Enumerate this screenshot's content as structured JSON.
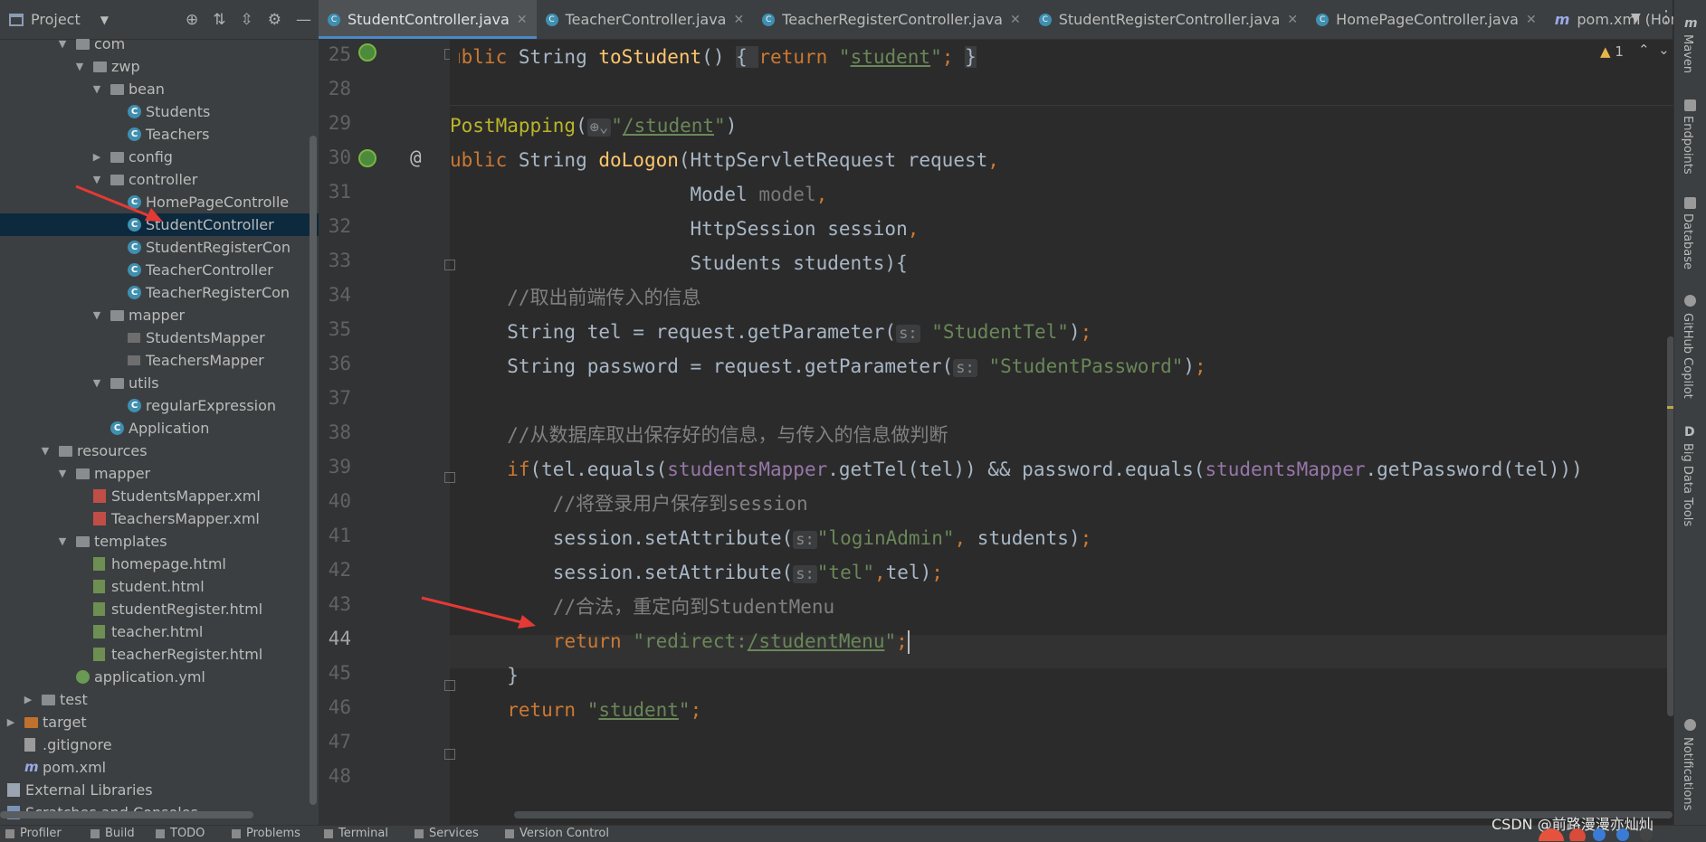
{
  "project_panel": {
    "title": "Project",
    "tree": [
      {
        "label": "com",
        "depth": 3,
        "icon": "folder",
        "expanded": true
      },
      {
        "label": "zwp",
        "depth": 4,
        "icon": "folder",
        "expanded": true
      },
      {
        "label": "bean",
        "depth": 5,
        "icon": "folder",
        "expanded": true
      },
      {
        "label": "Students",
        "depth": 6,
        "icon": "class"
      },
      {
        "label": "Teachers",
        "depth": 6,
        "icon": "class"
      },
      {
        "label": "config",
        "depth": 5,
        "icon": "folder",
        "expanded": false
      },
      {
        "label": "controller",
        "depth": 5,
        "icon": "folder",
        "expanded": true
      },
      {
        "label": "HomePageControlle",
        "depth": 6,
        "icon": "class"
      },
      {
        "label": "StudentController",
        "depth": 6,
        "icon": "class",
        "selected": true
      },
      {
        "label": "StudentRegisterCon",
        "depth": 6,
        "icon": "class"
      },
      {
        "label": "TeacherController",
        "depth": 6,
        "icon": "class"
      },
      {
        "label": "TeacherRegisterCon",
        "depth": 6,
        "icon": "class"
      },
      {
        "label": "mapper",
        "depth": 5,
        "icon": "folder",
        "expanded": true
      },
      {
        "label": "StudentsMapper",
        "depth": 6,
        "icon": "mapper"
      },
      {
        "label": "TeachersMapper",
        "depth": 6,
        "icon": "mapper"
      },
      {
        "label": "utils",
        "depth": 5,
        "icon": "folder",
        "expanded": true
      },
      {
        "label": "regularExpression",
        "depth": 6,
        "icon": "class"
      },
      {
        "label": "Application",
        "depth": 5,
        "icon": "class"
      },
      {
        "label": "resources",
        "depth": 2,
        "icon": "folder",
        "expanded": true
      },
      {
        "label": "mapper",
        "depth": 3,
        "icon": "folder",
        "expanded": true
      },
      {
        "label": "StudentsMapper.xml",
        "depth": 4,
        "icon": "xml"
      },
      {
        "label": "TeachersMapper.xml",
        "depth": 4,
        "icon": "xml"
      },
      {
        "label": "templates",
        "depth": 3,
        "icon": "folder",
        "expanded": true
      },
      {
        "label": "homepage.html",
        "depth": 4,
        "icon": "html"
      },
      {
        "label": "student.html",
        "depth": 4,
        "icon": "html"
      },
      {
        "label": "studentRegister.html",
        "depth": 4,
        "icon": "html"
      },
      {
        "label": "teacher.html",
        "depth": 4,
        "icon": "html"
      },
      {
        "label": "teacherRegister.html",
        "depth": 4,
        "icon": "html"
      },
      {
        "label": "application.yml",
        "depth": 3,
        "icon": "yml"
      },
      {
        "label": "test",
        "depth": 1,
        "icon": "folder",
        "expanded": false
      },
      {
        "label": "target",
        "depth": 0,
        "icon": "folder-orange",
        "expanded": false
      },
      {
        "label": ".gitignore",
        "depth": 0,
        "icon": "git"
      },
      {
        "label": "pom.xml",
        "depth": 0,
        "icon": "maven"
      },
      {
        "label": "External Libraries",
        "depth": -1,
        "icon": "library",
        "expanded": false
      },
      {
        "label": "Scratches and Consoles",
        "depth": -1,
        "icon": "scratch"
      }
    ]
  },
  "tabs": [
    {
      "label": "StudentController.java",
      "active": true,
      "icon": "class"
    },
    {
      "label": "TeacherController.java",
      "icon": "class"
    },
    {
      "label": "TeacherRegisterController.java",
      "icon": "class"
    },
    {
      "label": "StudentRegisterController.java",
      "icon": "class"
    },
    {
      "label": "HomePageController.java",
      "icon": "class"
    },
    {
      "label": "pom.xml (Home",
      "icon": "maven"
    }
  ],
  "editor": {
    "warnings": "1",
    "current_line": 44,
    "line_numbers": [
      "25",
      "28",
      "29",
      "30",
      "31",
      "32",
      "33",
      "34",
      "35",
      "36",
      "37",
      "38",
      "39",
      "40",
      "41",
      "42",
      "43",
      "44",
      "45",
      "46",
      "47",
      "48"
    ]
  },
  "right_tools": [
    "Maven",
    "Endpoints",
    "Database",
    "GitHub Copilot",
    "Big Data Tools",
    "Notifications"
  ],
  "bottom_tools": [
    "Profiler",
    "Build",
    "TODO",
    "Problems",
    "Terminal",
    "Services",
    "Version Control"
  ],
  "watermark": "CSDN @前路漫漫亦灿灿",
  "colors": {
    "keyword": "#cc7832",
    "function": "#ffc66d",
    "string": "#6a8759",
    "comment": "#808080",
    "field": "#9876aa",
    "annotation": "#bbb529",
    "selection": "#0d293e",
    "arrow": "#e53935"
  }
}
